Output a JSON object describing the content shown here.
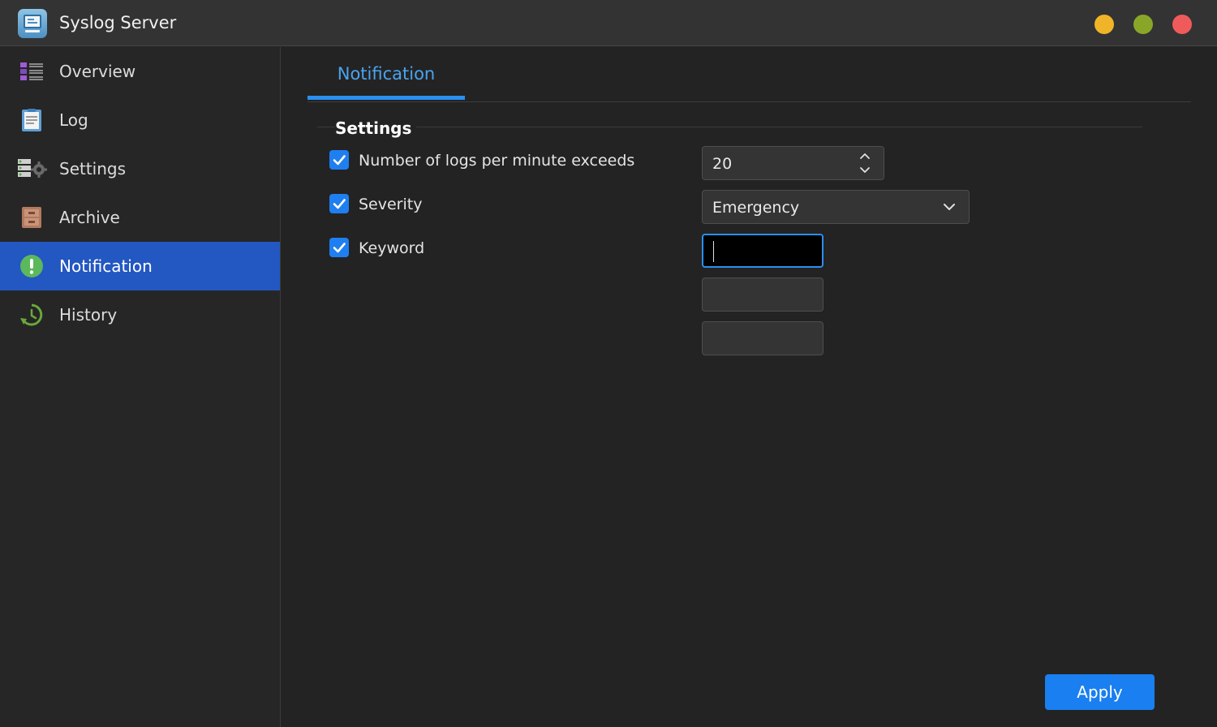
{
  "window": {
    "title": "Syslog Server"
  },
  "sidebar": {
    "items": [
      {
        "label": "Overview",
        "icon": "overview-icon"
      },
      {
        "label": "Log",
        "icon": "log-icon"
      },
      {
        "label": "Settings",
        "icon": "settings-icon"
      },
      {
        "label": "Archive",
        "icon": "archive-icon"
      },
      {
        "label": "Notification",
        "icon": "notification-icon",
        "active": true
      },
      {
        "label": "History",
        "icon": "history-icon"
      }
    ]
  },
  "tabs": [
    {
      "label": "Notification",
      "active": true
    }
  ],
  "section": {
    "title": "Settings"
  },
  "rows": {
    "logs_per_minute": {
      "label": "Number of logs per minute exceeds",
      "checked": true,
      "value": "20"
    },
    "severity": {
      "label": "Severity",
      "checked": true,
      "value": "Emergency"
    },
    "keyword": {
      "label": "Keyword",
      "checked": true,
      "values": [
        "",
        "",
        ""
      ]
    }
  },
  "actions": {
    "apply_label": "Apply"
  },
  "colors": {
    "accent": "#1a7ff0",
    "sidebar_active": "#2357c2",
    "minimize": "#f0b429",
    "maximize": "#8aa628",
    "close": "#ef5b5b"
  }
}
